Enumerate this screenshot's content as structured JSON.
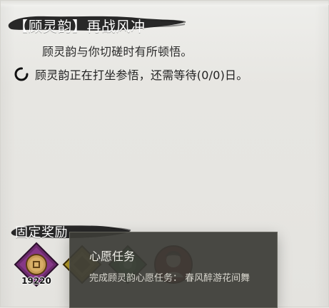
{
  "event": {
    "title": "【顾灵韵】再战风冲",
    "description": "顾灵韵与你切磋时有所顿悟。",
    "status_text": "顾灵韵正在打坐参悟，还需等待(0/0)日。"
  },
  "rewards": {
    "section_title": "固定奖励",
    "items": [
      {
        "icon": "coin-icon",
        "count": "19220",
        "frame_color": "#6a2a6b"
      },
      {
        "icon": "gold-diamond-icon",
        "count": "",
        "frame_color": "#b49b2a"
      },
      {
        "icon": "green-jade-icon",
        "count": "",
        "frame_color": "#2f6d3b"
      },
      {
        "icon": "character-portrait-icon",
        "count": "",
        "frame_color": "#7b1d1d"
      }
    ]
  },
  "tooltip": {
    "title": "心愿任务",
    "desc_prefix": "完成顾灵韵心愿任务：",
    "desc_quest": "春风醉游花间舞"
  },
  "colors": {
    "panel_bg": "#e7e6e2",
    "ink": "#1e1e1e",
    "tooltip_bg": "#3c3c37"
  }
}
